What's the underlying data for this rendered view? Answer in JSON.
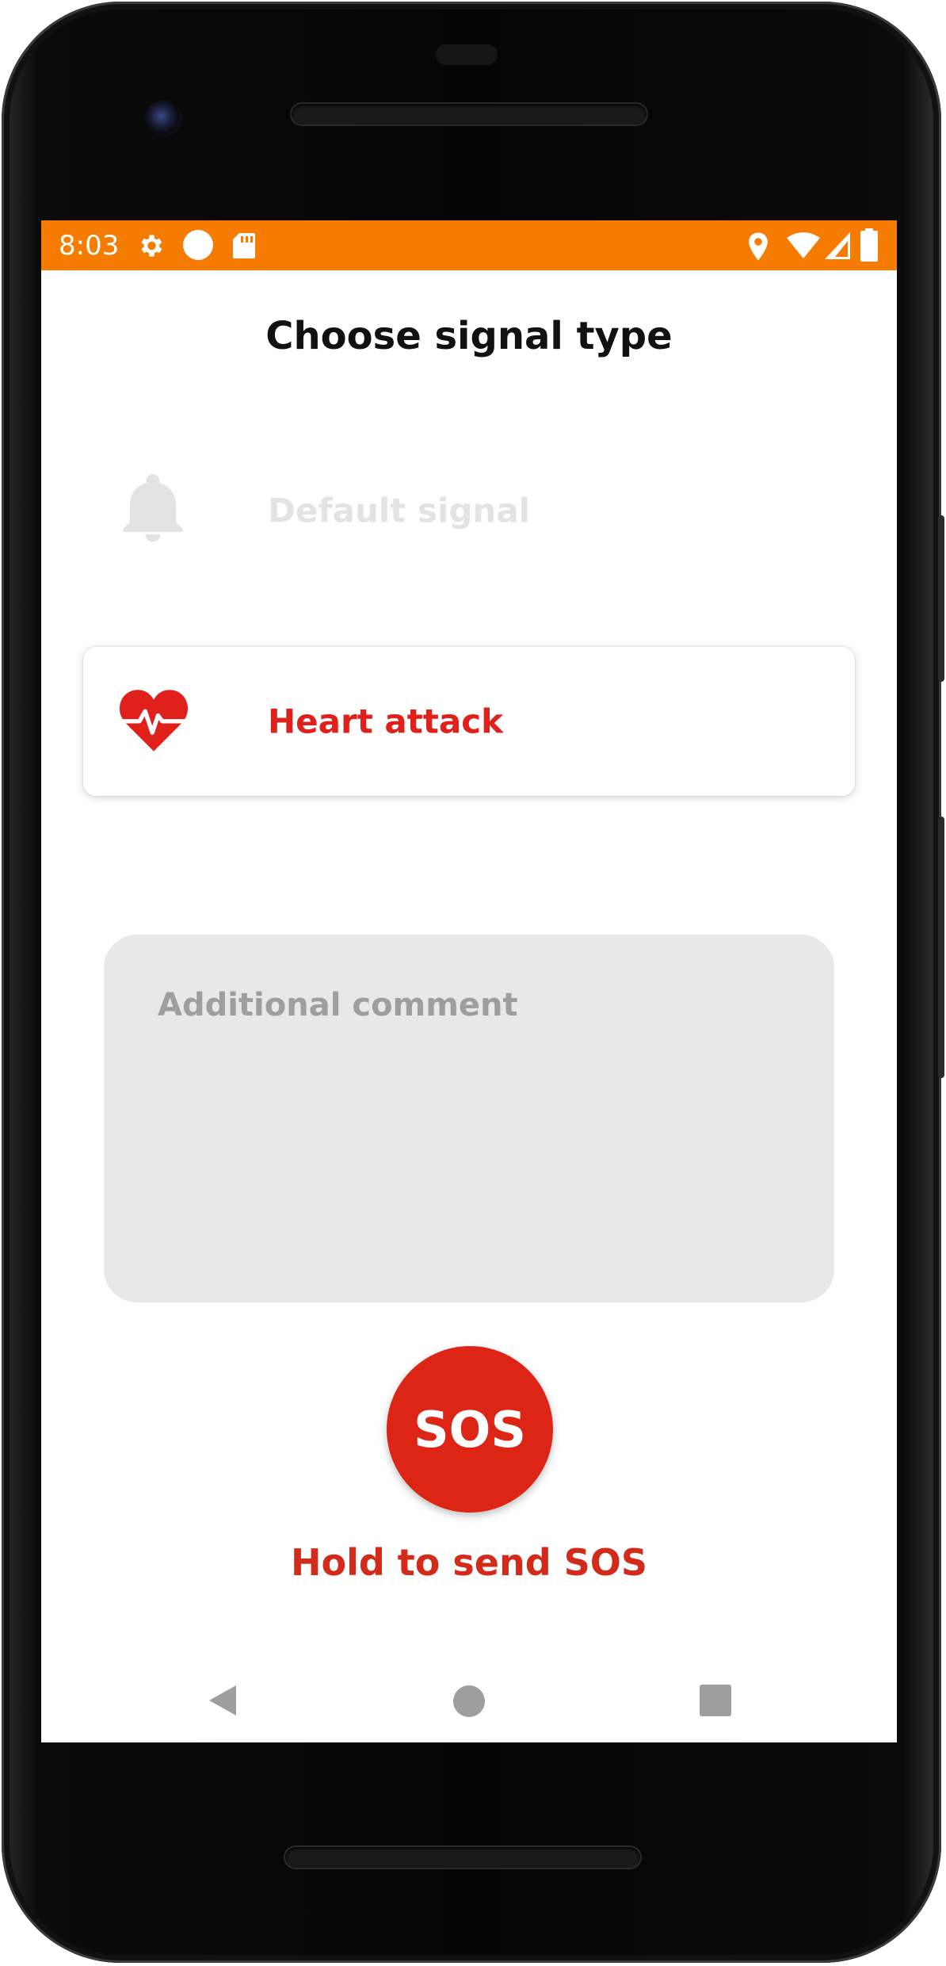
{
  "status_bar": {
    "time": "8:03",
    "background": "#f57c00",
    "left_icons": [
      "gear-icon",
      "circle-icon",
      "sd-card-icon"
    ],
    "right_icons": [
      "location-icon",
      "wifi-icon",
      "signal-icon",
      "battery-icon"
    ]
  },
  "screen": {
    "title": "Choose signal type"
  },
  "signal_options": [
    {
      "label": "Default signal",
      "icon": "bell-icon",
      "selected": false
    },
    {
      "label": "Heart attack",
      "icon": "heart-pulse-icon",
      "selected": true
    }
  ],
  "comment": {
    "placeholder": "Additional comment",
    "value": ""
  },
  "sos": {
    "button_label": "SOS",
    "hint": "Hold to send SOS",
    "color": "#dd2515"
  },
  "nav_bar": {
    "buttons": [
      "back-icon",
      "home-icon",
      "recents-icon"
    ]
  }
}
